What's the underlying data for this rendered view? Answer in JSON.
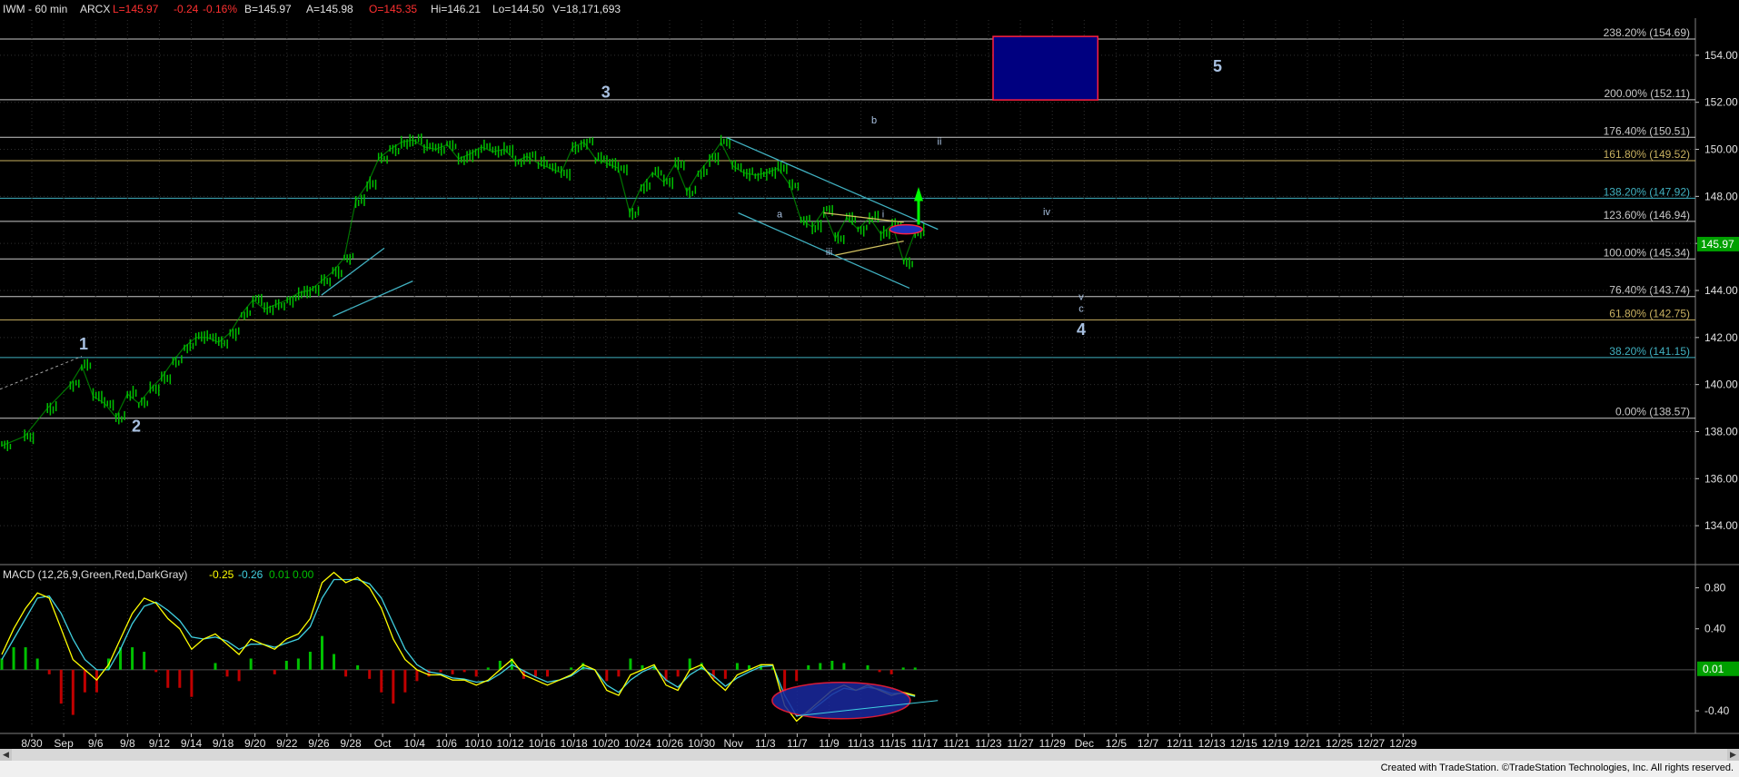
{
  "header": {
    "symbol": "IWM - 60 min",
    "exchange": "ARCX",
    "last": "L=145.97",
    "change": "-0.24",
    "change_pct": "-0.16%",
    "bid": "B=145.97",
    "ask": "A=145.98",
    "open": "O=145.35",
    "high": "Hi=146.21",
    "low": "Lo=144.50",
    "volume": "V=18,171,693"
  },
  "colors": {
    "background": "#000000",
    "price": "#00c000",
    "fib_line": "#c8c8c8",
    "channel": "#40b0c0",
    "label": "#a8c0e0",
    "macd": "#ffff00",
    "signal": "#40d0e0",
    "hist_pos": "#00c000",
    "hist_neg": "#c00000",
    "target_box": "#000080",
    "target_border": "#ff2040"
  },
  "chart_data": [
    {
      "type": "line",
      "title": "IWM - 60 min",
      "y_ticks": [
        "154.00",
        "152.00",
        "150.00",
        "148.00",
        "146.00",
        "144.00",
        "142.00",
        "140.00",
        "138.00",
        "136.00",
        "134.00"
      ],
      "ylim": [
        132.5,
        155.5
      ],
      "x_ticks": [
        "8/30",
        "Sep",
        "9/6",
        "9/8",
        "9/12",
        "9/14",
        "9/18",
        "9/20",
        "9/22",
        "9/26",
        "9/28",
        "Oct",
        "10/4",
        "10/6",
        "10/10",
        "10/12",
        "10/16",
        "10/18",
        "10/20",
        "10/24",
        "10/26",
        "10/30",
        "Nov",
        "11/3",
        "11/7",
        "11/9",
        "11/13",
        "11/15",
        "11/17",
        "11/21",
        "11/23",
        "11/27",
        "11/29",
        "Dec",
        "12/5",
        "12/7",
        "12/11",
        "12/13",
        "12/15",
        "12/19",
        "12/21",
        "12/25",
        "12/27",
        "12/29"
      ],
      "last_price_label": "145.97",
      "fib_levels": [
        {
          "label": "238.20% (154.69)",
          "value": 154.69,
          "color": "#c8c8c8"
        },
        {
          "label": "200.00% (152.11)",
          "value": 152.11,
          "color": "#c8c8c8"
        },
        {
          "label": "176.40% (150.51)",
          "value": 150.51,
          "color": "#c8c8c8"
        },
        {
          "label": "161.80% (149.52)",
          "value": 149.52,
          "color": "#c8b060"
        },
        {
          "label": "138.20% (147.92)",
          "value": 147.92,
          "color": "#40b0c0"
        },
        {
          "label": "123.60% (146.94)",
          "value": 146.94,
          "color": "#c8c8c8"
        },
        {
          "label": "100.00% (145.34)",
          "value": 145.34,
          "color": "#c8c8c8"
        },
        {
          "label": "76.40% (143.74)",
          "value": 143.74,
          "color": "#c8c8c8"
        },
        {
          "label": "61.80% (142.75)",
          "value": 142.75,
          "color": "#c8b060"
        },
        {
          "label": "38.20% (141.15)",
          "value": 141.15,
          "color": "#40b0c0"
        },
        {
          "label": "0.00% (138.57)",
          "value": 138.57,
          "color": "#c8c8c8"
        }
      ],
      "wave_labels": [
        {
          "text": "1",
          "x": "9/2",
          "y": 141.5,
          "size": "large"
        },
        {
          "text": "2",
          "x": "9/7",
          "y": 138.0,
          "size": "large"
        },
        {
          "text": "3",
          "x": "10/20",
          "y": 152.2,
          "size": "large"
        },
        {
          "text": "4",
          "x": "11/16",
          "y": 142.1,
          "size": "large"
        },
        {
          "text": "5",
          "x": "11/28",
          "y": 153.3,
          "size": "large"
        },
        {
          "text": "a",
          "x": "10/25",
          "y": 147.1,
          "size": "small"
        },
        {
          "text": "b",
          "x": "11/1",
          "y": 151.1,
          "size": "small"
        },
        {
          "text": "i",
          "x": "11/2",
          "y": 147.1,
          "size": "small"
        },
        {
          "text": "ii",
          "x": "11/5",
          "y": 150.2,
          "size": "small"
        },
        {
          "text": "iii",
          "x": "11/9",
          "y": 145.5,
          "size": "small"
        },
        {
          "text": "iv",
          "x": "11/14",
          "y": 147.2,
          "size": "small"
        },
        {
          "text": "v",
          "x": "11/16",
          "y": 143.6,
          "size": "small"
        },
        {
          "text": "c",
          "x": "11/16",
          "y": 143.1,
          "size": "small"
        }
      ],
      "price_path": [
        [
          0,
          137.4
        ],
        [
          2,
          137.8
        ],
        [
          4,
          139.0
        ],
        [
          6,
          140.0
        ],
        [
          7,
          140.8
        ],
        [
          8,
          139.5
        ],
        [
          9,
          139.2
        ],
        [
          10,
          138.6
        ],
        [
          11,
          139.6
        ],
        [
          12,
          139.2
        ],
        [
          13,
          139.8
        ],
        [
          14,
          140.3
        ],
        [
          15,
          141.0
        ],
        [
          16,
          141.6
        ],
        [
          17,
          142.0
        ],
        [
          18,
          142.0
        ],
        [
          19,
          141.8
        ],
        [
          20,
          142.2
        ],
        [
          21,
          143.0
        ],
        [
          22,
          143.6
        ],
        [
          23,
          143.2
        ],
        [
          24,
          143.4
        ],
        [
          25,
          143.6
        ],
        [
          26,
          143.9
        ],
        [
          27,
          144.0
        ],
        [
          28,
          144.4
        ],
        [
          29,
          144.8
        ],
        [
          30,
          145.4
        ],
        [
          31,
          147.8
        ],
        [
          32,
          148.5
        ],
        [
          33,
          149.6
        ],
        [
          34,
          150.0
        ],
        [
          35,
          150.3
        ],
        [
          36,
          150.4
        ],
        [
          37,
          150.1
        ],
        [
          38,
          150.0
        ],
        [
          39,
          150.2
        ],
        [
          40,
          149.6
        ],
        [
          41,
          149.8
        ],
        [
          42,
          150.1
        ],
        [
          43,
          149.9
        ],
        [
          44,
          150.0
        ],
        [
          45,
          149.5
        ],
        [
          46,
          149.7
        ],
        [
          47,
          149.4
        ],
        [
          48,
          149.2
        ],
        [
          49,
          149.0
        ],
        [
          50,
          150.1
        ],
        [
          51,
          150.3
        ],
        [
          52,
          149.6
        ],
        [
          53,
          149.4
        ],
        [
          54,
          149.2
        ],
        [
          55,
          147.3
        ],
        [
          56,
          148.4
        ],
        [
          57,
          149.0
        ],
        [
          58,
          148.6
        ],
        [
          59,
          149.4
        ],
        [
          60,
          148.2
        ],
        [
          61,
          149.0
        ],
        [
          62,
          149.6
        ],
        [
          63,
          150.3
        ],
        [
          64,
          149.3
        ],
        [
          65,
          149.0
        ],
        [
          66,
          148.9
        ],
        [
          67,
          149.0
        ],
        [
          68,
          149.2
        ],
        [
          69,
          148.5
        ],
        [
          70,
          147.0
        ],
        [
          71,
          146.7
        ],
        [
          72,
          147.4
        ],
        [
          73,
          146.2
        ],
        [
          74,
          147.1
        ],
        [
          75,
          146.6
        ],
        [
          76,
          147.1
        ],
        [
          77,
          146.4
        ],
        [
          78,
          146.8
        ],
        [
          79,
          145.2
        ],
        [
          80,
          146.5
        ]
      ],
      "trading_days_total": 81
    },
    {
      "type": "line",
      "title": "MACD (12,26,9,Green,Red,DarkGray)",
      "legend_values": [
        "-0.25",
        "-0.26",
        "0.01",
        "0.00"
      ],
      "y_ticks": [
        "0.80",
        "0.40",
        "-0.40"
      ],
      "ylim": [
        -0.55,
        1.0
      ],
      "last_value_label": "0.01",
      "series": [
        {
          "name": "MACD",
          "values": [
            0.15,
            0.4,
            0.6,
            0.75,
            0.7,
            0.4,
            0.1,
            0.0,
            -0.1,
            0.05,
            0.3,
            0.55,
            0.7,
            0.65,
            0.5,
            0.4,
            0.2,
            0.3,
            0.35,
            0.25,
            0.15,
            0.3,
            0.25,
            0.2,
            0.3,
            0.35,
            0.5,
            0.85,
            0.95,
            0.85,
            0.9,
            0.8,
            0.6,
            0.3,
            0.1,
            0.0,
            -0.05,
            -0.05,
            -0.1,
            -0.1,
            -0.15,
            -0.1,
            0.0,
            0.1,
            -0.05,
            -0.1,
            -0.15,
            -0.1,
            -0.05,
            0.05,
            0.0,
            -0.2,
            -0.25,
            -0.05,
            0.0,
            0.05,
            -0.15,
            -0.2,
            0.0,
            0.05,
            -0.1,
            -0.2,
            -0.05,
            0.0,
            0.05,
            0.05,
            -0.35,
            -0.5,
            -0.4,
            -0.3,
            -0.2,
            -0.15,
            -0.2,
            -0.15,
            -0.2,
            -0.25,
            -0.22,
            -0.25
          ]
        },
        {
          "name": "Signal",
          "values": [
            0.1,
            0.3,
            0.5,
            0.7,
            0.72,
            0.55,
            0.3,
            0.1,
            0.0,
            0.0,
            0.2,
            0.45,
            0.62,
            0.66,
            0.58,
            0.48,
            0.32,
            0.3,
            0.32,
            0.28,
            0.2,
            0.25,
            0.25,
            0.22,
            0.26,
            0.3,
            0.42,
            0.7,
            0.88,
            0.88,
            0.88,
            0.84,
            0.7,
            0.45,
            0.2,
            0.05,
            -0.02,
            -0.04,
            -0.08,
            -0.09,
            -0.12,
            -0.11,
            -0.04,
            0.05,
            -0.01,
            -0.07,
            -0.12,
            -0.1,
            -0.06,
            0.02,
            0.0,
            -0.15,
            -0.22,
            -0.1,
            -0.02,
            0.03,
            -0.1,
            -0.17,
            -0.05,
            0.02,
            -0.06,
            -0.16,
            -0.08,
            -0.02,
            0.03,
            0.04,
            -0.25,
            -0.45,
            -0.42,
            -0.33,
            -0.24,
            -0.18,
            -0.2,
            -0.17,
            -0.19,
            -0.23,
            -0.23,
            -0.26
          ]
        }
      ]
    }
  ],
  "footer": {
    "credit": "Created with TradeStation. ©TradeStation Technologies, Inc. All rights reserved."
  }
}
